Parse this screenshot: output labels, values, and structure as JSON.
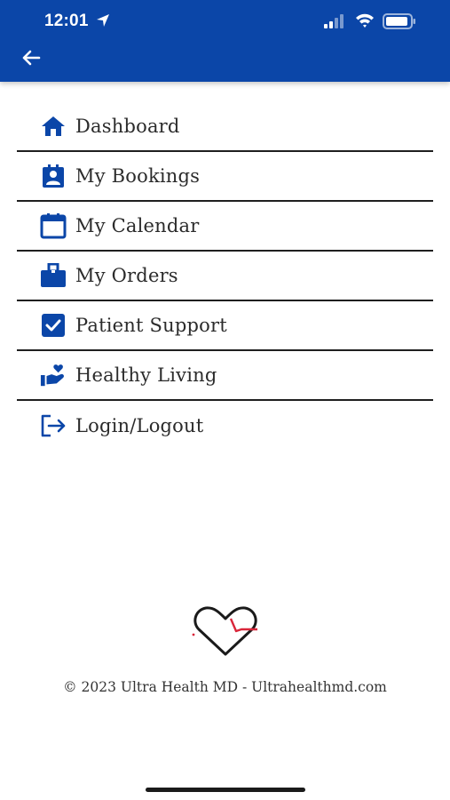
{
  "status_bar": {
    "time": "12:01"
  },
  "header": {
    "back_icon": "arrow-left-icon"
  },
  "menu": {
    "items": [
      {
        "label": "Dashboard",
        "icon": "home-icon"
      },
      {
        "label": "My Bookings",
        "icon": "contact-card-icon"
      },
      {
        "label": "My Calendar",
        "icon": "calendar-icon"
      },
      {
        "label": "My Orders",
        "icon": "orders-box-icon"
      },
      {
        "label": "Patient Support",
        "icon": "checkbox-icon"
      },
      {
        "label": "Healthy Living",
        "icon": "hand-heart-icon"
      },
      {
        "label": "Login/Logout",
        "icon": "logout-icon"
      }
    ]
  },
  "footer": {
    "copyright": "© 2023 Ultra Health MD - Ultrahealthmd.com"
  },
  "colors": {
    "brand_blue": "#0b46a8",
    "icon_blue": "#0b46a8",
    "logo_red": "#d9263a"
  }
}
